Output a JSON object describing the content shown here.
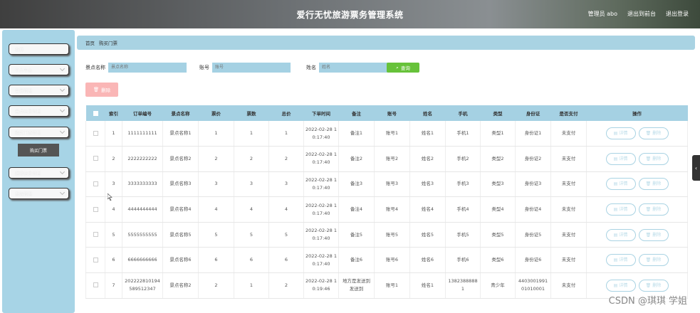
{
  "header": {
    "title": "爱行无忧旅游票务管理系统",
    "admin": "管理员 abo",
    "back_to_front": "退出到前台",
    "logout": "退出登录"
  },
  "sidebar": {
    "items": [
      {
        "label": "首页",
        "has_chevron": false
      },
      {
        "label": "个人中心",
        "has_chevron": true
      },
      {
        "label": "会员管理",
        "has_chevron": true
      },
      {
        "label": "景点信息管理",
        "has_chevron": true
      },
      {
        "label": "购买门票管理",
        "has_chevron": true
      },
      {
        "label": "系统管理",
        "has_chevron": true
      }
    ],
    "sub_item": "购买门票",
    "extra_item": "返修信息管理"
  },
  "breadcrumb": {
    "home": "首页",
    "current": "购买门票"
  },
  "search": {
    "scenic_label": "景点名称",
    "scenic_placeholder": "景点名称",
    "account_label": "账号",
    "account_placeholder": "账号",
    "name_label": "姓名",
    "name_placeholder": "姓名",
    "search_button": "查询"
  },
  "delete_button": "删除",
  "table": {
    "headers": [
      "",
      "索引",
      "订单编号",
      "景点名称",
      "票价",
      "票数",
      "总价",
      "下单时间",
      "备注",
      "账号",
      "姓名",
      "手机",
      "类型",
      "身份证",
      "是否支付",
      "操作"
    ],
    "rows": [
      [
        "1",
        "1111111111",
        "景点名称1",
        "1",
        "1",
        "1",
        "2022-02-28 10:17:40",
        "备注1",
        "账号1",
        "姓名1",
        "手机1",
        "类型1",
        "身份证1",
        "未支付"
      ],
      [
        "2",
        "2222222222",
        "景点名称2",
        "2",
        "2",
        "2",
        "2022-02-28 10:17:40",
        "备注2",
        "账号2",
        "姓名2",
        "手机2",
        "类型2",
        "身份证2",
        "未支付"
      ],
      [
        "3",
        "3333333333",
        "景点名称3",
        "3",
        "3",
        "3",
        "2022-02-28 10:17:40",
        "备注3",
        "账号3",
        "姓名3",
        "手机3",
        "类型3",
        "身份证3",
        "未支付"
      ],
      [
        "4",
        "4444444444",
        "景点名称4",
        "4",
        "4",
        "4",
        "2022-02-28 10:17:40",
        "备注4",
        "账号4",
        "姓名4",
        "手机4",
        "类型4",
        "身份证4",
        "未支付"
      ],
      [
        "5",
        "5555555555",
        "景点名称5",
        "5",
        "5",
        "5",
        "2022-02-28 10:17:40",
        "备注5",
        "账号5",
        "姓名5",
        "手机5",
        "类型5",
        "身份证5",
        "未支付"
      ],
      [
        "6",
        "6666666666",
        "景点名称6",
        "6",
        "6",
        "6",
        "2022-02-28 10:17:40",
        "备注6",
        "账号6",
        "姓名6",
        "手机6",
        "类型6",
        "身份证6",
        "未支付"
      ],
      [
        "7",
        "202222810194589512347",
        "景点名称2",
        "2",
        "1",
        "2",
        "2022-02-28 10:19:46",
        "地方是发送到发送到",
        "账号1",
        "姓名1",
        "13823888881",
        "青少年",
        "440300199101010001",
        "未支付"
      ]
    ],
    "detail_button": "详情",
    "delete_button": "删除"
  },
  "side_tab": "‹",
  "watermark": "CSDN @琪琪 学姐"
}
